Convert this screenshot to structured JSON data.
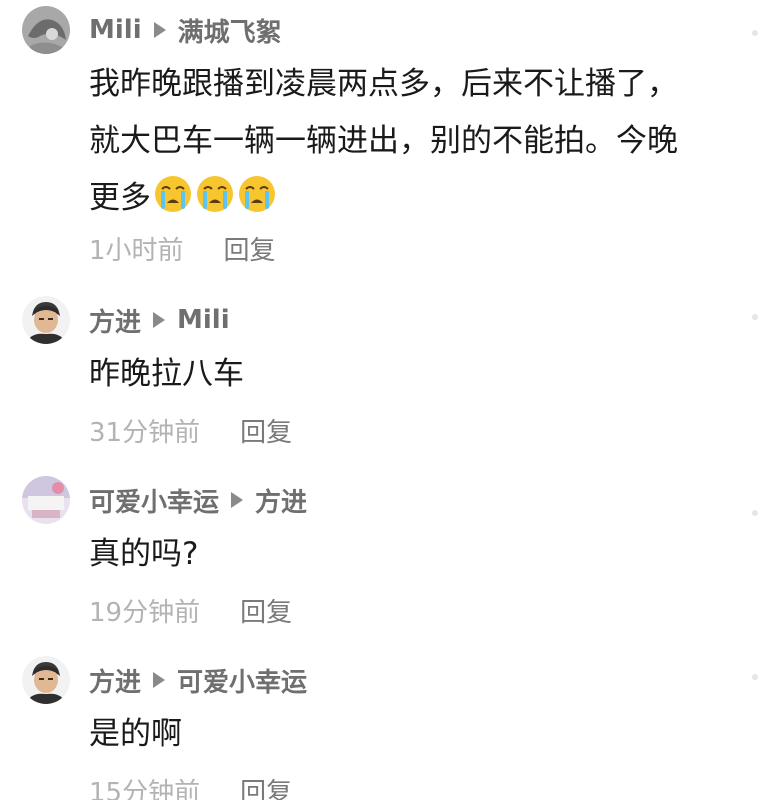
{
  "comments": [
    {
      "author": "Mili",
      "reply_to": "满城飞絮",
      "text_lines": [
        "我昨晚跟播到凌晨两点多，后来不让播了，",
        "就大巴车一辆一辆进出，别的不能拍。今晚",
        "更多"
      ],
      "emoji": "loudly-crying-face",
      "time": "1小时前",
      "reply_label": "回复"
    },
    {
      "author": "方进",
      "reply_to": "Mili",
      "text_lines": [
        "昨晚拉八车"
      ],
      "time": "31分钟前",
      "reply_label": "回复"
    },
    {
      "author": "可爱小幸运",
      "reply_to": "方进",
      "text_lines": [
        "真的吗?"
      ],
      "time": "19分钟前",
      "reply_label": "回复"
    },
    {
      "author": "方进",
      "reply_to": "可爱小幸运",
      "text_lines": [
        "是的啊"
      ],
      "time": "15分钟前",
      "reply_label": "回复"
    }
  ],
  "colors": {
    "name": "#6f6f6f",
    "text": "#1a1a1a",
    "time": "#b3b3b3",
    "reply": "#7a7a7a",
    "background": "#ffffff"
  }
}
